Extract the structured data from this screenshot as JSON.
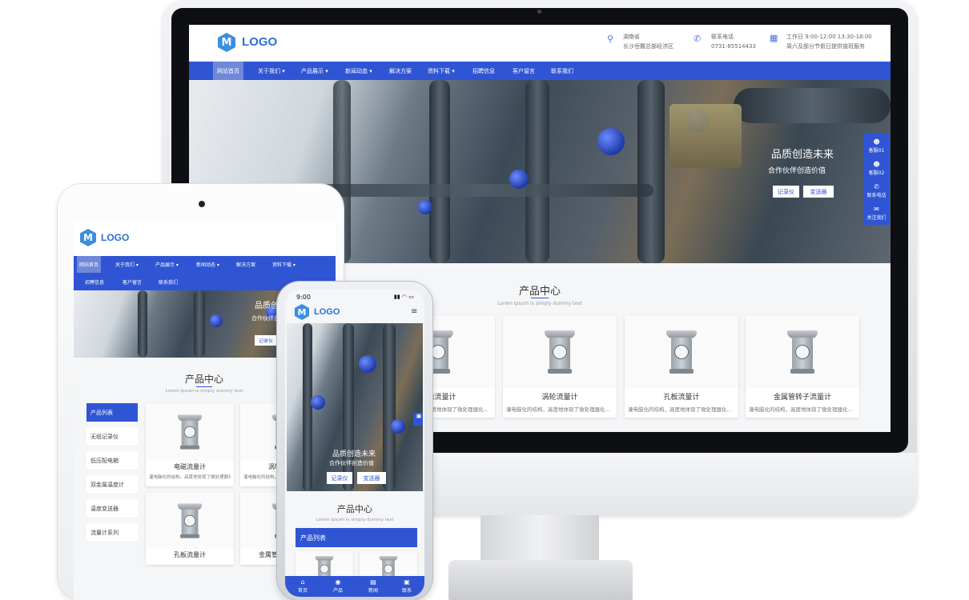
{
  "brand": {
    "logo_mark": "M",
    "logo_text": "LOGO",
    "accent": "#2f55d4"
  },
  "header": {
    "location_label": "湖南省",
    "location_value": "长沙岳麓总部经济区",
    "phone_label": "联系电话",
    "phone_value": "0731-85514433",
    "hours_label": "工作日 9:00-12:00 13:30-18:00",
    "hours_value": "周六及部分节假日提供值班服务"
  },
  "nav": {
    "items": [
      "网站首页",
      "关于我们 ▾",
      "产品展示 ▾",
      "新闻动态 ▾",
      "解决方案",
      "资料下载 ▾",
      "招聘信息",
      "客户留言",
      "联系我们"
    ]
  },
  "hero": {
    "title": "品质创造未来",
    "subtitle": "合作伙伴创造价值",
    "btn_recorder": "记录仪",
    "btn_transmitter": "变送器"
  },
  "products": {
    "title": "产品中心",
    "subtitle": "Lorem Ipsum is simply dummy text",
    "list_label": "产品列表",
    "desc": "灌电脑化的结构，高度地体现了微处理器化...",
    "items": [
      {
        "name": "电磁流量计"
      },
      {
        "name": "涡轮流量计"
      },
      {
        "name": "孔板流量计"
      },
      {
        "name": "金属管转子流量计"
      }
    ]
  },
  "side_tools": [
    "客服01",
    "客服02",
    "联系电话",
    "关注我们"
  ],
  "tablet": {
    "categories": [
      "产品列表",
      "无纸记录仪",
      "低压配电箱",
      "双金属温度计",
      "温度变送器",
      "流量计系列"
    ]
  },
  "phone": {
    "time": "9:00",
    "tabs": [
      "首页",
      "产品",
      "新闻",
      "联系"
    ]
  }
}
